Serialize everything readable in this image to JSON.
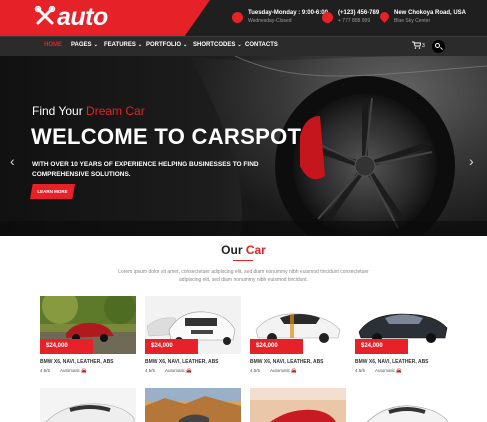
{
  "brand": {
    "logo_text": "auto",
    "accent": "#e62128"
  },
  "topbar": {
    "hours": {
      "title": "Tuesday-Monday : 9:00-6:00",
      "sub": "Wednesday-Closed"
    },
    "phone": {
      "title": "(+123) 456-789",
      "sub": "+ 777 888 999"
    },
    "address": {
      "title": "New Chokoya Road, USA",
      "sub": "Blue Sky Center"
    }
  },
  "nav": {
    "items": [
      {
        "label": "HOME",
        "caret": ""
      },
      {
        "label": "PAGES",
        "caret": "⌄"
      },
      {
        "label": "FEATURES",
        "caret": "⌄"
      },
      {
        "label": "PORTFOLIO",
        "caret": "⌄"
      },
      {
        "label": "SHORTCODES",
        "caret": "⌄"
      },
      {
        "label": "CONTACTS",
        "caret": ""
      }
    ],
    "cart_count": "3",
    "cart_icon": "shopping-cart-icon",
    "search_icon": "search-icon"
  },
  "hero": {
    "subtitle_prefix": "Find Your ",
    "subtitle_highlight": "Dream Car",
    "title": "WELCOME TO CARSPOT",
    "text": "WITH OVER 10 YEARS OF EXPERIENCE HELPING BUSINESSES TO FIND COMPREHENSIVE SOLUTIONS.",
    "button": "LEARN MORE",
    "prev": "‹",
    "next": "›"
  },
  "section": {
    "title_prefix": "Our ",
    "title_highlight": "Car",
    "description": "Lorem ipsum dolor sit amet, consectetuer adipiscing elit, sed diam nonummy nibh euismod tincidunt consectetuer adipiscing elit, sed diam nonummy nibh euismod tincidunt."
  },
  "cars": [
    {
      "price": "$24,000",
      "name": "BMW X6, NAVI, LEATHER, ABS",
      "rating": "4.5/5",
      "transmission": "Automatic"
    },
    {
      "price": "$24,000",
      "name": "BMW X6, NAVI, LEATHER, ABS",
      "rating": "4.5/5",
      "transmission": "Automatic"
    },
    {
      "price": "$24,000",
      "name": "BMW X6, NAVI, LEATHER, ABS",
      "rating": "4.5/5",
      "transmission": "Automatic"
    },
    {
      "price": "$24,000",
      "name": "BMW X6, NAVI, LEATHER, ABS",
      "rating": "4.5/5",
      "transmission": "Automatic"
    }
  ]
}
